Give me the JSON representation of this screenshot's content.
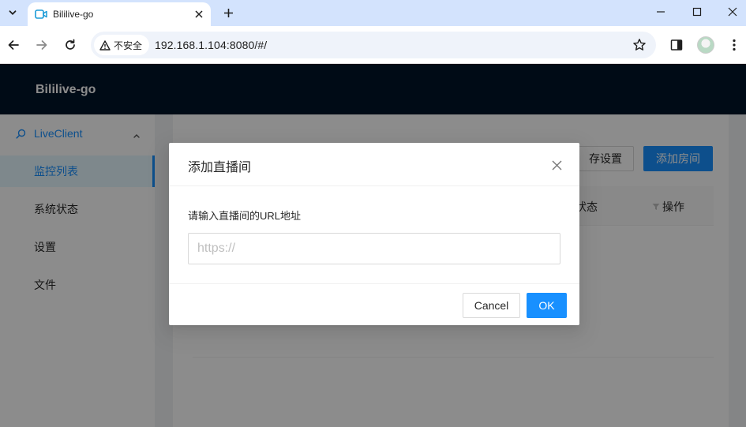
{
  "browser": {
    "tab_title": "Bililive-go",
    "security_label": "不安全",
    "url": "192.168.1.104:8080/#/"
  },
  "app": {
    "brand": "Bililive-go",
    "sidebar": {
      "group_label": "LiveClient",
      "items": [
        {
          "label": "监控列表",
          "active": true
        },
        {
          "label": "系统状态",
          "active": false
        },
        {
          "label": "设置",
          "active": false
        },
        {
          "label": "文件",
          "active": false
        }
      ]
    },
    "toolbar": {
      "store_settings_label": "存设置",
      "add_room_label": "添加房间"
    },
    "table": {
      "status_header": "状态",
      "action_header": "操作"
    }
  },
  "modal": {
    "title": "添加直播间",
    "field_label": "请输入直播间的URL地址",
    "input_placeholder": "https://",
    "input_value": "",
    "cancel_label": "Cancel",
    "ok_label": "OK"
  },
  "colors": {
    "primary": "#1890ff",
    "header_bg": "#001529",
    "browser_tabbar": "#d3e3fd"
  }
}
